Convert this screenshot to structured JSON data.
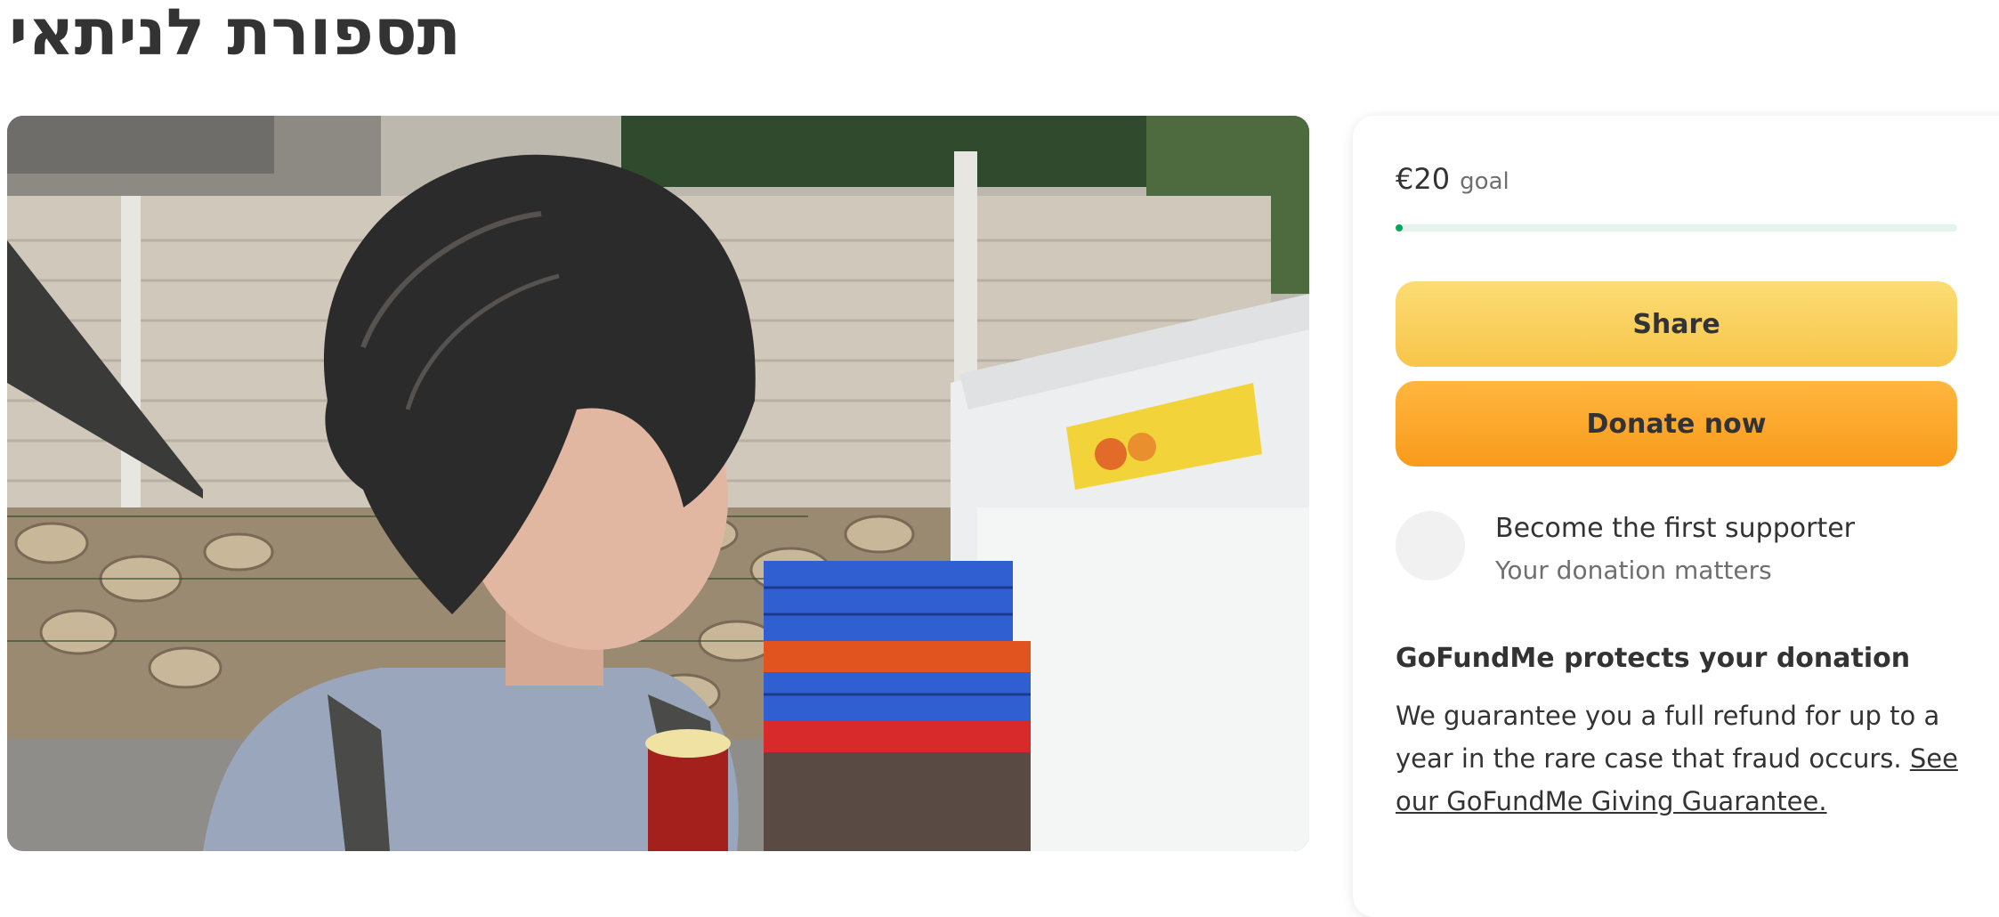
{
  "page": {
    "title": "תספורת לניתאי"
  },
  "campaign": {
    "photo_alt": "",
    "goal": {
      "amount": "€20",
      "label": "goal",
      "progress_fraction": 0.01,
      "progress_color": "#02a95c"
    },
    "buttons": {
      "share_label": "Share",
      "donate_label": "Donate now"
    },
    "supporter": {
      "title": "Become the first supporter",
      "subtitle": "Your donation matters"
    },
    "protection": {
      "heading": "GoFundMe protects your donation",
      "text": "We guarantee you a full refund for up to a year in the rare case that fraud occurs.",
      "link_text": "See our GoFundMe Giving Guarantee."
    }
  },
  "colors": {
    "share_button": "#f9d05e",
    "donate_button": "#fca926",
    "text": "#333333"
  }
}
